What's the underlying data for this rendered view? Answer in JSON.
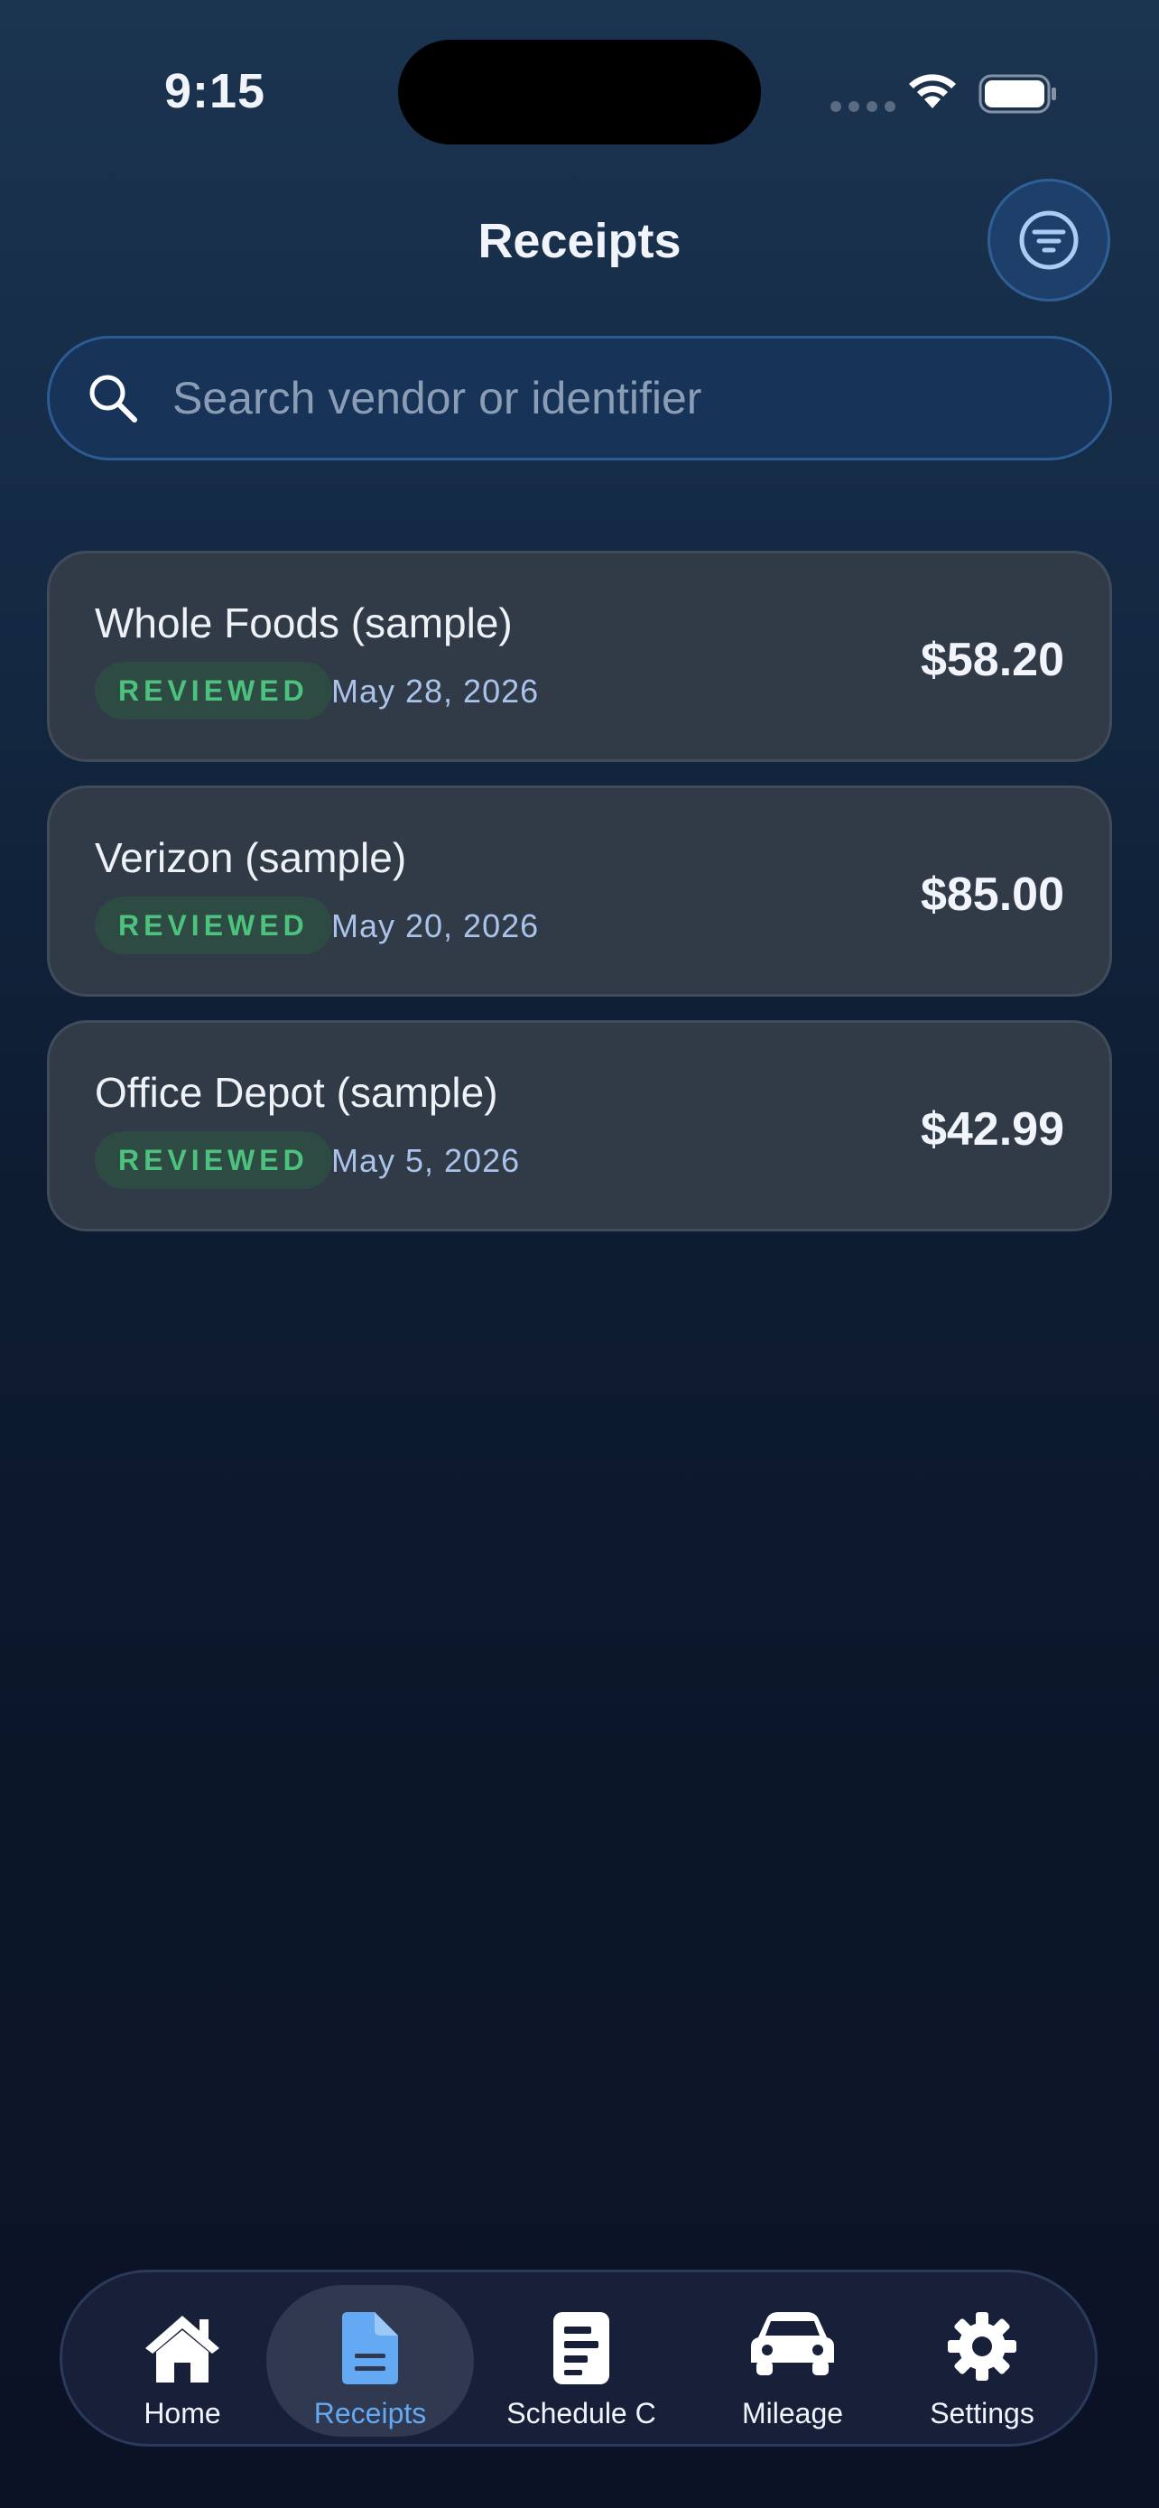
{
  "status_bar": {
    "time": "9:15"
  },
  "header": {
    "title": "Receipts"
  },
  "search": {
    "placeholder": "Search vendor or identifier"
  },
  "receipts": [
    {
      "vendor": "Whole Foods (sample)",
      "status": "REVIEWED",
      "date": "May 28, 2026",
      "amount": "$58.20"
    },
    {
      "vendor": "Verizon (sample)",
      "status": "REVIEWED",
      "date": "May 20, 2026",
      "amount": "$85.00"
    },
    {
      "vendor": "Office Depot (sample)",
      "status": "REVIEWED",
      "date": "May 5, 2026",
      "amount": "$42.99"
    }
  ],
  "tabs": [
    {
      "label": "Home",
      "icon": "home-icon",
      "active": false
    },
    {
      "label": "Receipts",
      "icon": "document-icon",
      "active": true
    },
    {
      "label": "Schedule C",
      "icon": "form-icon",
      "active": false
    },
    {
      "label": "Mileage",
      "icon": "car-icon",
      "active": false
    },
    {
      "label": "Settings",
      "icon": "gear-icon",
      "active": false
    }
  ],
  "colors": {
    "accent": "#63a9f3",
    "reviewed_badge": "#4cc27e",
    "card_background": "#313a47"
  }
}
